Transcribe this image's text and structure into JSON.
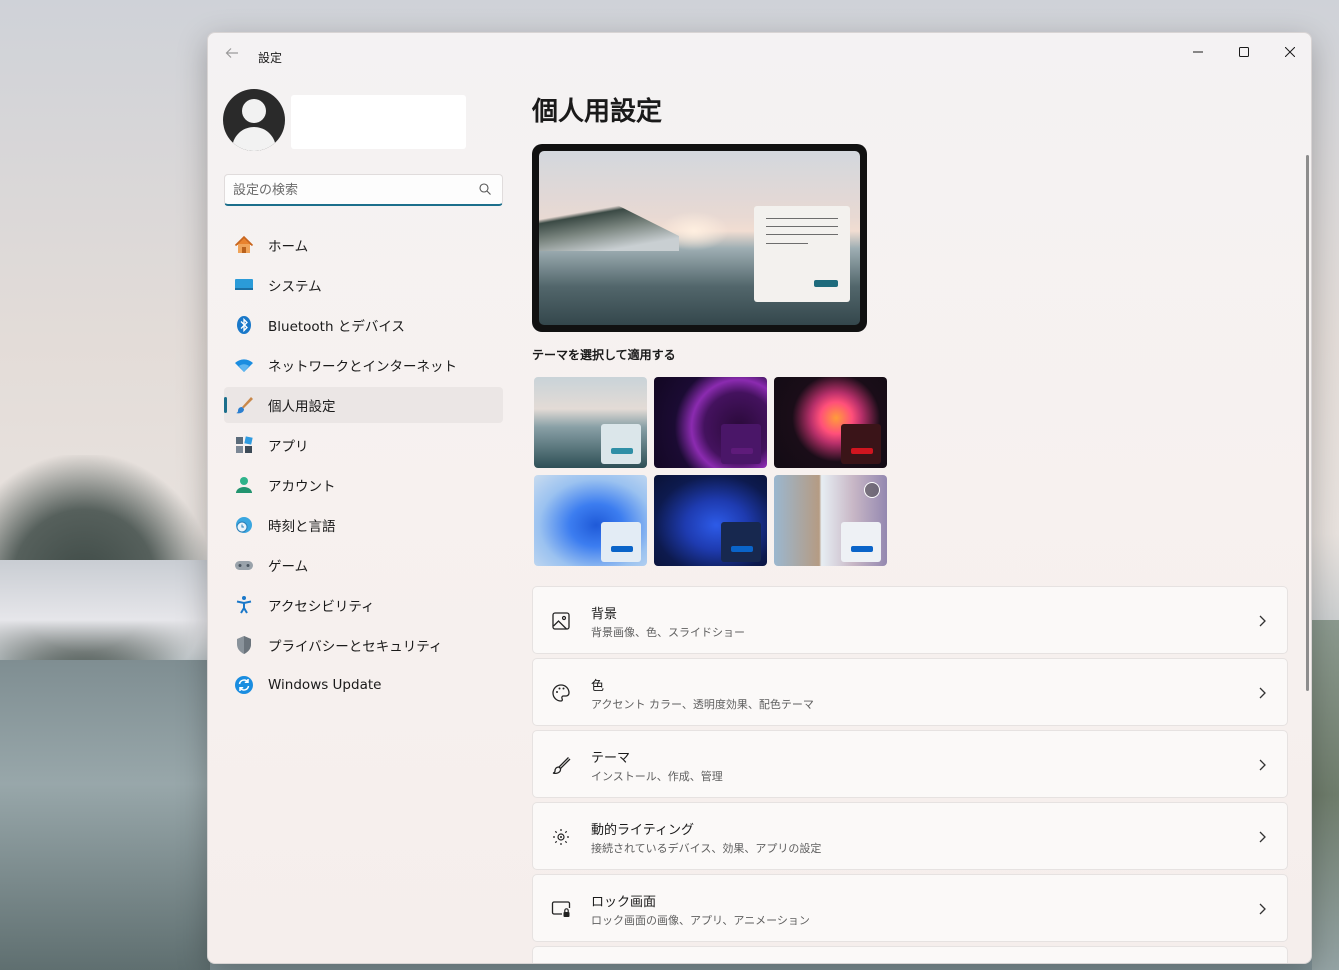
{
  "window": {
    "title": "設定"
  },
  "caption": {
    "minimize": "—",
    "maximize": "□",
    "close": "✕"
  },
  "search": {
    "placeholder": "設定の検索"
  },
  "sidebar": {
    "items": [
      {
        "label": "ホーム",
        "icon": "home-icon"
      },
      {
        "label": "システム",
        "icon": "system-icon"
      },
      {
        "label": "Bluetooth とデバイス",
        "icon": "bluetooth-icon"
      },
      {
        "label": "ネットワークとインターネット",
        "icon": "wifi-icon"
      },
      {
        "label": "個人用設定",
        "icon": "brush-icon",
        "active": true
      },
      {
        "label": "アプリ",
        "icon": "apps-icon"
      },
      {
        "label": "アカウント",
        "icon": "account-icon"
      },
      {
        "label": "時刻と言語",
        "icon": "clock-globe-icon"
      },
      {
        "label": "ゲーム",
        "icon": "gamepad-icon"
      },
      {
        "label": "アクセシビリティ",
        "icon": "accessibility-icon"
      },
      {
        "label": "プライバシーとセキュリティ",
        "icon": "shield-icon"
      },
      {
        "label": "Windows Update",
        "icon": "update-icon"
      }
    ]
  },
  "main": {
    "title": "個人用設定",
    "theme_heading": "テーマを選択して適用する",
    "accent_colors": {
      "theme1": "#2f8fa6",
      "theme2": "#5e1b7a",
      "theme3": "#d0151f",
      "theme4": "#0a64c9",
      "theme5": "#0a64c9",
      "theme6": "#0a64c9"
    },
    "cards": [
      {
        "title": "背景",
        "subtitle": "背景画像、色、スライドショー",
        "icon": "image-icon"
      },
      {
        "title": "色",
        "subtitle": "アクセント カラー、透明度効果、配色テーマ",
        "icon": "palette-icon"
      },
      {
        "title": "テーマ",
        "subtitle": "インストール、作成、管理",
        "icon": "brush-icon"
      },
      {
        "title": "動的ライティング",
        "subtitle": "接続されているデバイス、効果、アプリの設定",
        "icon": "lighting-icon"
      },
      {
        "title": "ロック画面",
        "subtitle": "ロック画面の画像、アプリ、アニメーション",
        "icon": "lock-screen-icon"
      }
    ]
  }
}
